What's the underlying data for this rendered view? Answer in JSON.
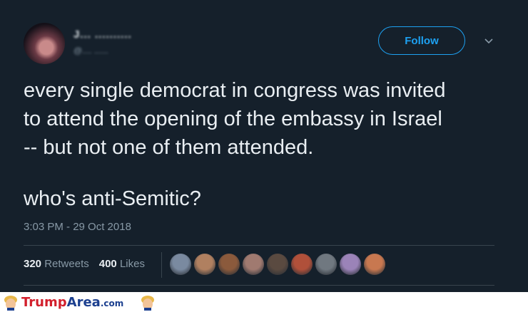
{
  "tweet": {
    "author_name": "J... ..........",
    "author_handle": "@.... ......",
    "follow_label": "Follow",
    "lines": [
      "every single democrat in congress was invited",
      "to attend the opening of the embassy in Israel",
      "-- but not one of them attended."
    ],
    "question": "who's anti-Semitic?",
    "timestamp": "3:03 PM - 29 Oct 2018",
    "retweets_count": "320",
    "retweets_label": "Retweets",
    "likes_count": "400",
    "likes_label": "Likes",
    "liker_avatar_colors": [
      "#7a8aa0",
      "#b08060",
      "#8b5a3c",
      "#a07a70",
      "#5a4a40",
      "#b0503a",
      "#707880",
      "#9b83b8",
      "#c87850"
    ]
  },
  "footer": {
    "logo_part1": "Trump",
    "logo_part2": "Area",
    "logo_suffix": ".com"
  },
  "colors": {
    "background": "#15202b",
    "accent": "#1da1f2",
    "text": "#e9eef2",
    "muted": "#8899a6"
  }
}
